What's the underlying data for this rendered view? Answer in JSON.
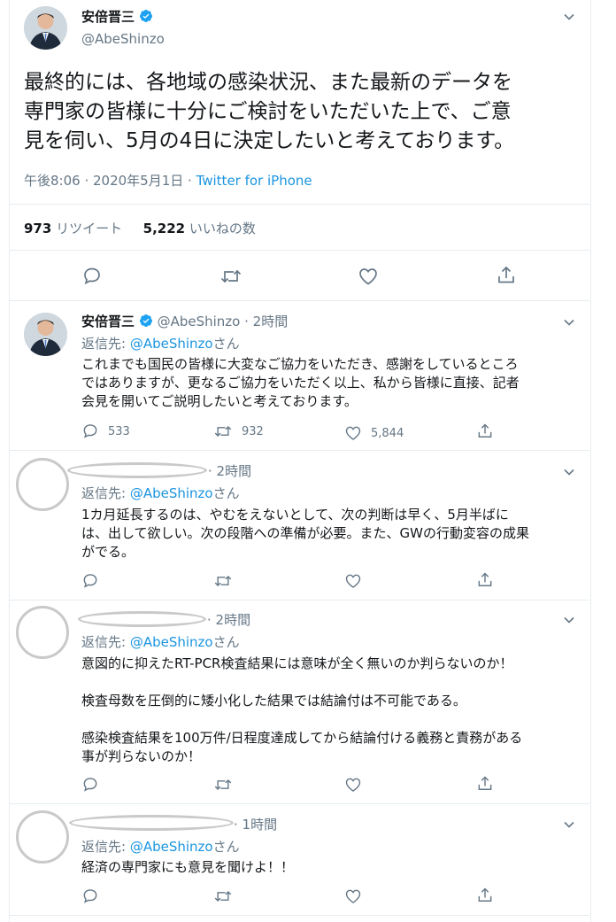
{
  "main_tweet": {
    "name": "安倍晋三",
    "handle": "@AbeShinzo",
    "text_lines": [
      "最終的には、各地域の感染状況、また最新のデータを",
      "専門家の皆様に十分にご検討をいただいた上で、ご意",
      "見を伺い、5月の4日に決定したいと考えております。"
    ],
    "time": "午後8:06 · 2020年5月1日 · ",
    "source": "Twitter for iPhone",
    "retweets_count": "973",
    "retweets_label": "リツイート",
    "likes_count": "5,222",
    "likes_label": "いいねの数"
  },
  "replies": [
    {
      "name": "安倍晋三",
      "handle": "@AbeShinzo",
      "time": "· 2時間",
      "reply_prefix": "返信先: ",
      "reply_to": "@AbeShinzo",
      "reply_suffix": "さん",
      "lines": [
        "これまでも国民の皆様に大変なご協力をいただき、感謝をしているところ",
        "ではありますが、更なるご協力をいただく以上、私から皆様に直接、記者",
        "会見を開いてご説明したいと考えております。"
      ],
      "reply_count": "533",
      "retweet_count": "932",
      "like_count": "5,844"
    },
    {
      "time": "· 2時間",
      "reply_prefix": "返信先: ",
      "reply_to": "@AbeShinzo",
      "reply_suffix": "さん",
      "lines": [
        "1カ月延長するのは、やむをえないとして、次の判断は早く、5月半ばに",
        "は、出して欲しい。次の段階への準備が必要。また、GWの行動変容の成果",
        "がでる。"
      ]
    },
    {
      "time": "· 2時間",
      "reply_prefix": "返信先: ",
      "reply_to": "@AbeShinzo",
      "reply_suffix": "さん",
      "lines": [
        "意図的に抑えたRT-PCR検査結果には意味が全く無いのか判らないのか！",
        "",
        "検査母数を圧倒的に矮小化した結果では結論付は不可能である。",
        "",
        "感染検査結果を100万件/日程度達成してから結論付ける義務と責務がある",
        "事が判らないのか！"
      ]
    },
    {
      "time": "· 1時間",
      "reply_prefix": "返信先: ",
      "reply_to": "@AbeShinzo",
      "reply_suffix": "さん",
      "lines": [
        "経済の専門家にも意見を聞けよ！！"
      ]
    }
  ],
  "colors": {
    "accent": "#1b95e0",
    "muted": "#657786",
    "border": "#e6ecf0"
  }
}
